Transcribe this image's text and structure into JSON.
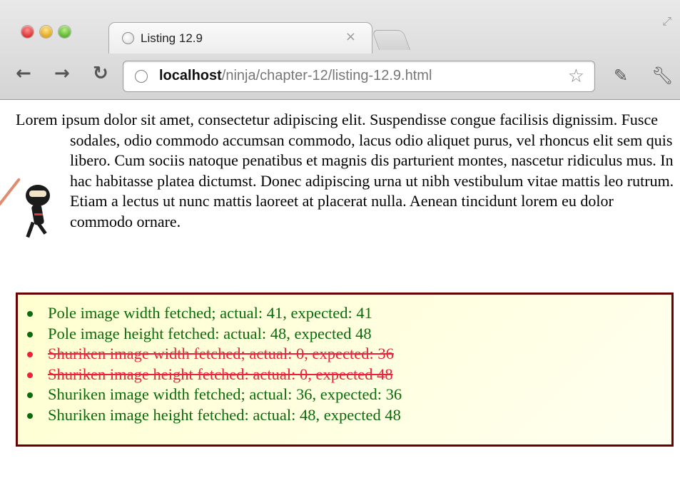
{
  "browser": {
    "tab_title": "Listing 12.9",
    "tab_close": "×",
    "url_host": "localhost",
    "url_path": "/ninja/chapter-12/listing-12.9.html"
  },
  "icons": {
    "back": "back-arrow-icon",
    "forward": "forward-arrow-icon",
    "reload": "reload-icon",
    "star": "bookmark-star-icon",
    "extension": "extension-icon",
    "wrench": "wrench-icon",
    "fullscreen": "fullscreen-icon",
    "ninja_image": "ninja-icon"
  },
  "content": {
    "paragraph_before": "Lorem ipsum dolor sit amet, consectetur adipiscing elit. Suspendisse congue facilisis dignissim. Fusce sodales, odio commodo accumsan commodo, lacus",
    "paragraph_after": "odio aliquet purus, vel rhoncus elit sem quis libero. Cum sociis natoque penatibus et magnis dis parturient montes, nascetur ridiculus mus. In hac habitasse platea dictumst. Donec adipiscing urna ut nibh vestibulum vitae mattis leo rutrum. Etiam a lectus ut nunc mattis laoreet at placerat nulla. Aenean tincidunt lorem eu dolor commodo ornare."
  },
  "results": [
    {
      "text": "Pole image width fetched; actual: 41, expected: 41",
      "status": "pass"
    },
    {
      "text": "Pole image height fetched: actual: 48, expected 48",
      "status": "pass"
    },
    {
      "text": "Shuriken image width fetched; actual: 0, expected: 36",
      "status": "fail"
    },
    {
      "text": "Shuriken image height fetched: actual: 0, expected 48",
      "status": "fail"
    },
    {
      "text": "Shuriken image width fetched; actual: 36, expected: 36",
      "status": "pass"
    },
    {
      "text": "Shuriken image height fetched: actual: 48, expected 48",
      "status": "pass"
    }
  ],
  "colors": {
    "pass": "#0a6b0a",
    "fail": "#e8233b",
    "results_border": "#6b0000",
    "results_background": "#ffffd0"
  }
}
